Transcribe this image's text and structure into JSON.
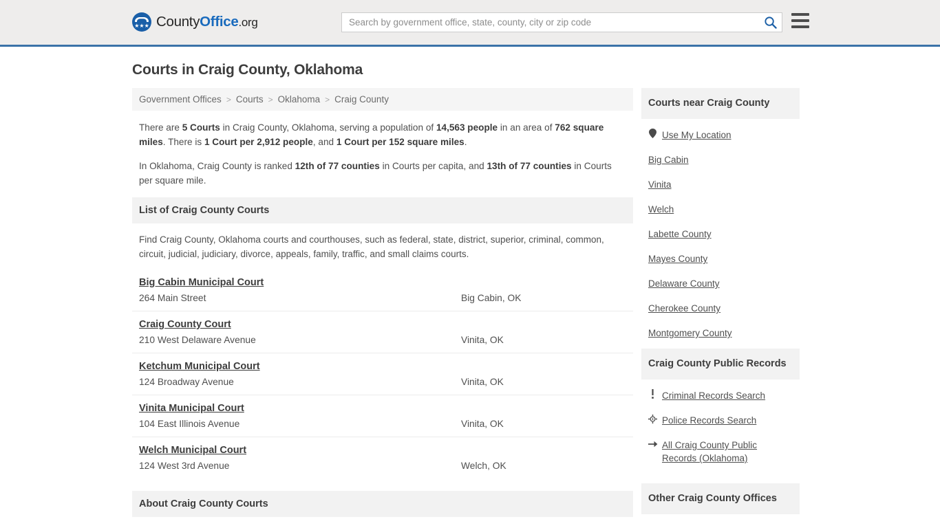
{
  "header": {
    "brand": {
      "part1": "County",
      "part2": "Office",
      "part3": ".org",
      "mark": "eagle-seal-icon",
      "stars": "★★★"
    },
    "search": {
      "placeholder": "Search by government office, state, county, city or zip code",
      "value": ""
    },
    "menu_label": "Menu"
  },
  "page": {
    "title": "Courts in Craig County, Oklahoma"
  },
  "breadcrumb": {
    "items": [
      {
        "label": "Government Offices"
      },
      {
        "label": "Courts"
      },
      {
        "label": "Oklahoma"
      },
      {
        "label": "Craig County"
      }
    ],
    "separator": ">"
  },
  "intro": {
    "p1": [
      {
        "t": "There are ",
        "b": false
      },
      {
        "t": "5 Courts",
        "b": true
      },
      {
        "t": " in Craig County, Oklahoma, serving a population of ",
        "b": false
      },
      {
        "t": "14,563 people",
        "b": true
      },
      {
        "t": " in an area of ",
        "b": false
      },
      {
        "t": "762 square miles",
        "b": true
      },
      {
        "t": ". There is ",
        "b": false
      },
      {
        "t": "1 Court per 2,912 people",
        "b": true
      },
      {
        "t": ", and ",
        "b": false
      },
      {
        "t": "1 Court per 152 square miles",
        "b": true
      },
      {
        "t": ".",
        "b": false
      }
    ],
    "p2": [
      {
        "t": "In Oklahoma, Craig County is ranked ",
        "b": false
      },
      {
        "t": "12th of 77 counties",
        "b": true
      },
      {
        "t": " in Courts per capita, and ",
        "b": false
      },
      {
        "t": "13th of 77 counties",
        "b": true
      },
      {
        "t": " in Courts per square mile.",
        "b": false
      }
    ]
  },
  "list_section": {
    "title": "List of Craig County Courts",
    "description": "Find Craig County, Oklahoma courts and courthouses, such as federal, state, district, superior, criminal, common, circuit, judicial, judiciary, divorce, appeals, family, traffic, and small claims courts.",
    "courts": [
      {
        "name": "Big Cabin Municipal Court",
        "address": "264 Main Street",
        "city": "Big Cabin, OK"
      },
      {
        "name": "Craig County Court",
        "address": "210 West Delaware Avenue",
        "city": "Vinita, OK"
      },
      {
        "name": "Ketchum Municipal Court",
        "address": "124 Broadway Avenue",
        "city": "Vinita, OK"
      },
      {
        "name": "Vinita Municipal Court",
        "address": "104 East Illinois Avenue",
        "city": "Vinita, OK"
      },
      {
        "name": "Welch Municipal Court",
        "address": "124 West 3rd Avenue",
        "city": "Welch, OK"
      }
    ]
  },
  "about_section": {
    "title": "About Craig County Courts"
  },
  "sidebar": {
    "nearby": {
      "title": "Courts near Craig County",
      "links": [
        {
          "label": "Use My Location",
          "icon": "map-pin-icon"
        },
        {
          "label": "Big Cabin",
          "icon": ""
        },
        {
          "label": "Vinita",
          "icon": ""
        },
        {
          "label": "Welch",
          "icon": ""
        },
        {
          "label": "Labette County",
          "icon": ""
        },
        {
          "label": "Mayes County",
          "icon": ""
        },
        {
          "label": "Delaware County",
          "icon": ""
        },
        {
          "label": "Cherokee County",
          "icon": ""
        },
        {
          "label": "Montgomery County",
          "icon": ""
        }
      ]
    },
    "records": {
      "title": "Craig County Public Records",
      "links": [
        {
          "label": "Criminal Records Search",
          "icon": "exclamation-icon",
          "glyph": "❗"
        },
        {
          "label": "Police Records Search",
          "icon": "police-badge-icon",
          "glyph": "✛"
        },
        {
          "label": "All Craig County Public Records (Oklahoma)",
          "icon": "arrow-right-icon",
          "glyph": "➜"
        }
      ]
    },
    "other": {
      "title": "Other Craig County Offices"
    }
  },
  "colors": {
    "header_bg": "#eeedec",
    "header_border": "#3b72a8",
    "brand_blue": "#1a6bbd",
    "section_bg": "#f2f2f2",
    "text": "#4f4f4f"
  }
}
